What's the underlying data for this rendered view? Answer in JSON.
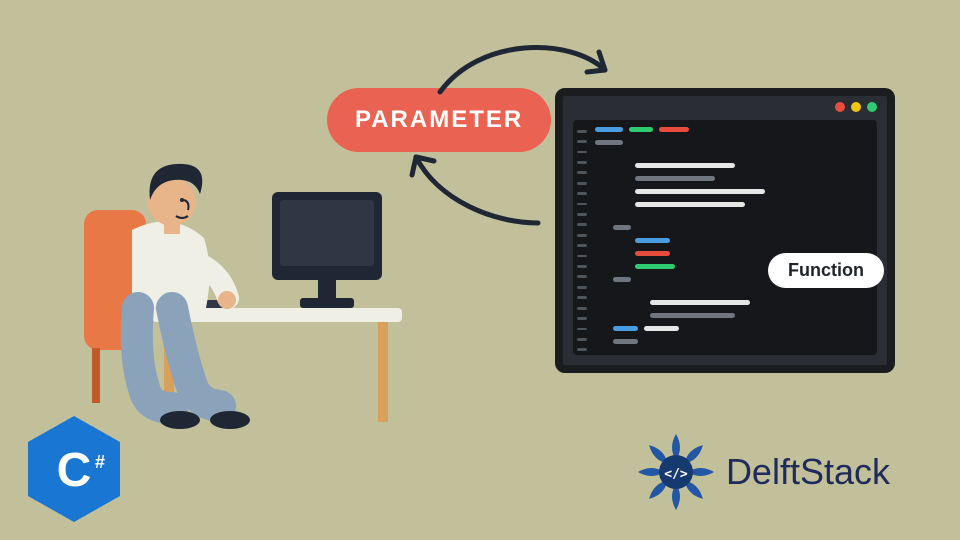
{
  "badges": {
    "parameter": "PARAMETER",
    "function": "Function"
  },
  "colors": {
    "background": "#c1c09a",
    "parameter_bg": "#EA6352",
    "function_bg": "#ffffff",
    "csharp": "#1976D2",
    "delft_blue": "#1f2b5a",
    "arrow": "#1e2733"
  },
  "logos": {
    "language": "C#",
    "brand": "DelftStack",
    "brand_icon": "</>"
  },
  "illustration": {
    "subject": "Programmer at desk with monitor",
    "desk_color": "#f0efe5",
    "chair_color": "#e87845",
    "monitor_color": "#1e2733",
    "shirt_color": "#f0efe5",
    "pants_color": "#8aa3bb",
    "hair_color": "#1e2733"
  },
  "code_editor": {
    "brace": "{",
    "gutter_lines": 22,
    "traffic_lights": [
      "red",
      "yellow",
      "green"
    ]
  },
  "arrows": {
    "arrow1": "parameter-to-code",
    "arrow2": "code-to-parameter"
  }
}
